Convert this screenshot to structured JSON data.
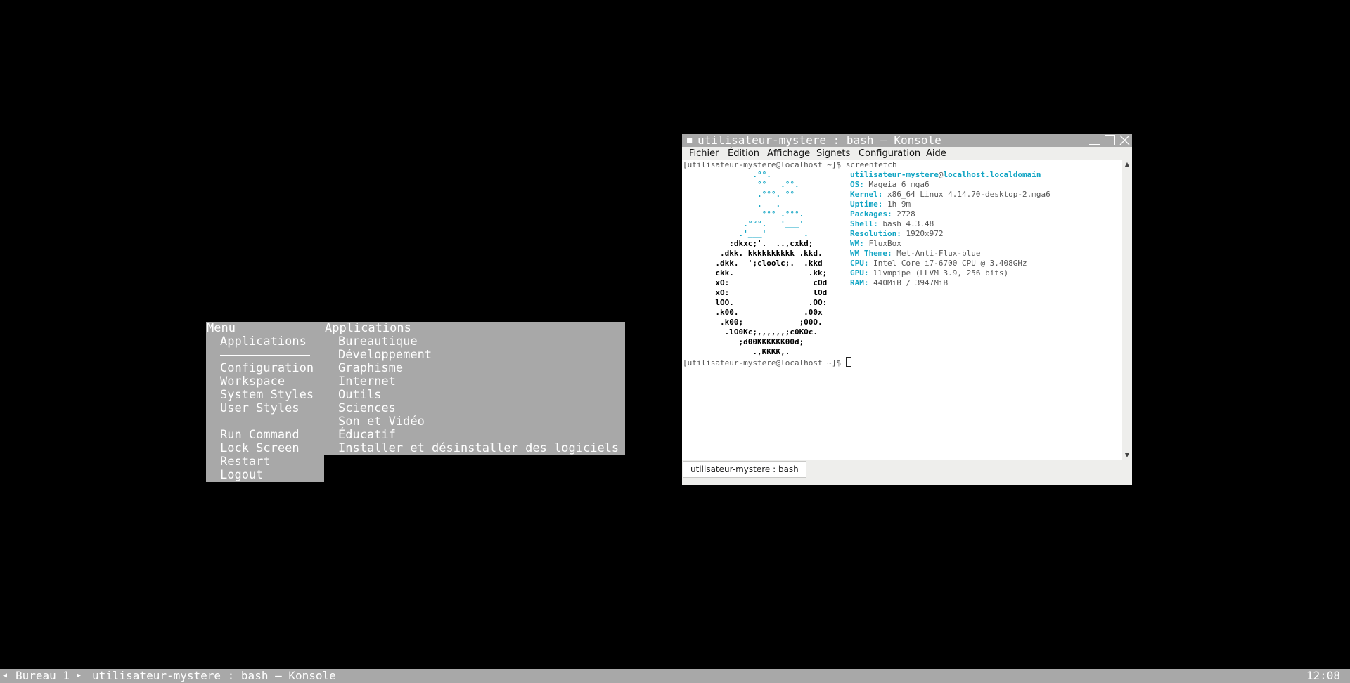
{
  "root_menu": {
    "title": "Menu",
    "items": [
      "Applications",
      "Configuration",
      "Workspace",
      "System Styles",
      "User Styles",
      "Run Command",
      "Lock Screen",
      "Restart",
      "Logout"
    ]
  },
  "apps_menu": {
    "title": "Applications",
    "items": [
      "Bureautique",
      "Développement",
      "Graphisme",
      "Internet",
      "Outils",
      "Sciences",
      "Son et Vidéo",
      "Éducatif",
      "Installer et désinstaller des logiciels"
    ]
  },
  "konsole": {
    "title": "utilisateur-mystere : bash — Konsole",
    "menubar": [
      "Fichier",
      "Édition",
      "Affichage",
      "Signets",
      "Configuration",
      "Aide"
    ],
    "tab_label": "utilisateur-mystere : bash",
    "terminal": {
      "prompt1": "[utilisateur-mystere@localhost ~]$ screenfetch",
      "prompt2": "[utilisateur-mystere@localhost ~]$ ",
      "user_host": {
        "user": "utilisateur-mystere",
        "at": "@",
        "host": "localhost.localdomain"
      },
      "info": [
        {
          "key": "OS:",
          "value": "Mageia 6 mga6"
        },
        {
          "key": "Kernel:",
          "value": "x86_64 Linux 4.14.70-desktop-2.mga6"
        },
        {
          "key": "Uptime:",
          "value": "1h 9m"
        },
        {
          "key": "Packages:",
          "value": "2728"
        },
        {
          "key": "Shell:",
          "value": "bash 4.3.48"
        },
        {
          "key": "Resolution:",
          "value": "1920x972"
        },
        {
          "key": "WM:",
          "value": "FluxBox"
        },
        {
          "key": "WM Theme:",
          "value": "Met-Anti-Flux-blue"
        },
        {
          "key": "CPU:",
          "value": "Intel Core i7-6700 CPU @ 3.408GHz"
        },
        {
          "key": "GPU:",
          "value": "llvmpipe (LLVM 3.9, 256 bits)"
        },
        {
          "key": "RAM:",
          "value": "440MiB / 3947MiB"
        }
      ],
      "logo_cyan": [
        "               .°°.",
        "                °°   .°°.",
        "                .°°°. °°",
        "                .   .",
        "                 °°° .°°°.",
        "             .°°°.   '___'",
        "            .'___'        ."
      ],
      "logo_white": [
        "          :dkxc;'.  ..,cxkd;",
        "        .dkk. kkkkkkkkkk .kkd.",
        "       .dkk.  ';cloolc;.  .kkd",
        "       ckk.                .kk;",
        "       xO:                  cOd",
        "       xO:                  lOd",
        "       lOO.                .OO:",
        "       .k00.              .00x",
        "        .k00;            ;00O.",
        "         .lO0Kc;,,,,,,;c0KOc.",
        "            ;d00KKKKKK00d;",
        "               .,KKKK,."
      ]
    }
  },
  "toolbar": {
    "workspace": "Bureau 1",
    "window_title": "utilisateur-mystere : bash — Konsole",
    "clock": "12:08"
  },
  "colors": {
    "menu_bg": "#a8a8a8",
    "terminal_cyan": "#12a5c4",
    "desktop": "#000000"
  }
}
